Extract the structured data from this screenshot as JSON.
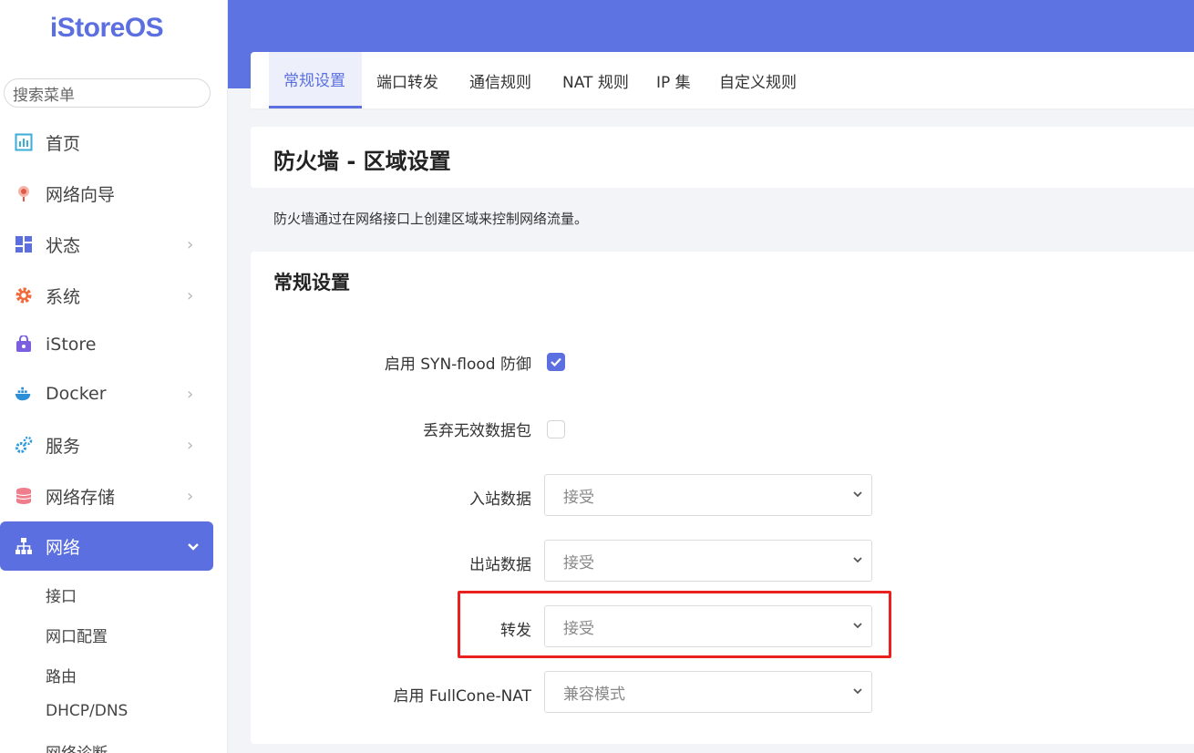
{
  "app": {
    "logo": "iStoreOS"
  },
  "sidebar": {
    "search_placeholder": "搜索菜单",
    "items": [
      {
        "label": "首页",
        "icon": "dashboard-icon",
        "color": "#3aaed8"
      },
      {
        "label": "网络向导",
        "icon": "wizard-icon",
        "color": "#e05a4a"
      },
      {
        "label": "状态",
        "icon": "status-grid-icon",
        "color": "#5b6fe0"
      },
      {
        "label": "系统",
        "icon": "gear-icon",
        "color": "#f06a3a"
      },
      {
        "label": "iStore",
        "icon": "store-bag-icon",
        "color": "#7b5fe0"
      },
      {
        "label": "Docker",
        "icon": "docker-icon",
        "color": "#2d8fd8"
      },
      {
        "label": "服务",
        "icon": "services-cog-icon",
        "color": "#2d9ae0"
      },
      {
        "label": "网络存储",
        "icon": "storage-db-icon",
        "color": "#ef7d8c"
      },
      {
        "label": "网络",
        "icon": "network-tree-icon",
        "color": "#ffffff"
      }
    ],
    "sub_items": [
      "接口",
      "网口配置",
      "路由",
      "DHCP/DNS",
      "网络诊断"
    ]
  },
  "tabs": [
    "常规设置",
    "端口转发",
    "通信规则",
    "NAT 规则",
    "IP 集",
    "自定义规则"
  ],
  "page": {
    "title": "防火墙 - 区域设置",
    "description": "防火墙通过在网络接口上创建区域来控制网络流量。"
  },
  "general": {
    "section_title": "常规设置",
    "syn_flood_label": "启用 SYN-flood 防御",
    "syn_flood_checked": true,
    "drop_invalid_label": "丢弃无效数据包",
    "drop_invalid_checked": false,
    "input_label": "入站数据",
    "input_value": "接受",
    "output_label": "出站数据",
    "output_value": "接受",
    "forward_label": "转发",
    "forward_value": "接受",
    "fullcone_label": "启用 FullCone-NAT",
    "fullcone_value": "兼容模式"
  },
  "colors": {
    "accent": "#5b6fe0",
    "banner": "#5d73e2",
    "highlight": "#e8201e"
  }
}
